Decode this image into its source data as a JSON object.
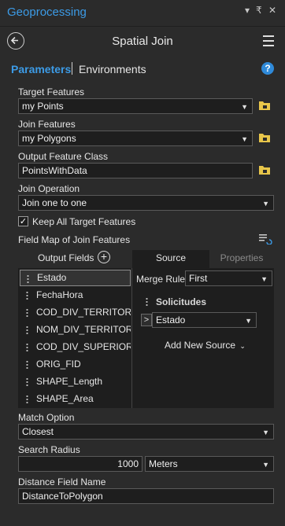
{
  "window": {
    "title": "Geoprocessing",
    "controls": [
      "▾",
      "₹",
      "✕"
    ]
  },
  "header": {
    "title": "Spatial Join"
  },
  "tabs": {
    "parameters": "Parameters",
    "environments": "Environments",
    "help": "?"
  },
  "target_features": {
    "label": "Target Features",
    "value": "my Points"
  },
  "join_features": {
    "label": "Join Features",
    "value": "my Polygons"
  },
  "output_feature_class": {
    "label": "Output Feature Class",
    "value": "PointsWithData"
  },
  "join_operation": {
    "label": "Join Operation",
    "value": "Join one to one"
  },
  "keep_all": {
    "label": "Keep All Target Features",
    "checked": true,
    "mark": "✓"
  },
  "field_map": {
    "label": "Field Map of Join Features",
    "output_fields_label": "Output Fields",
    "add_symbol": "+",
    "fields": [
      "Estado",
      "FechaHora",
      "COD_DIV_TERRITORIAL",
      "NOM_DIV_TERRITORIAL",
      "COD_DIV_SUPERIOR",
      "ORIG_FID",
      "SHAPE_Length",
      "SHAPE_Area"
    ],
    "selected_index": 0,
    "source_tab": "Source",
    "properties_tab": "Properties",
    "merge_rule_label": "Merge Rule",
    "merge_rule_value": "First",
    "source_name": "Solicitudes",
    "source_field": "Estado",
    "expand_symbol": ">",
    "add_new_source": "Add New Source"
  },
  "match_option": {
    "label": "Match Option",
    "value": "Closest"
  },
  "search_radius": {
    "label": "Search Radius",
    "value": "1000",
    "unit": "Meters"
  },
  "distance_field": {
    "label": "Distance Field Name",
    "value": "DistanceToPolygon"
  },
  "colors": {
    "accent": "#3c9be6",
    "background": "#2b2b2b",
    "field_bg": "#1e1e1e",
    "folder": "#e8c64a"
  }
}
